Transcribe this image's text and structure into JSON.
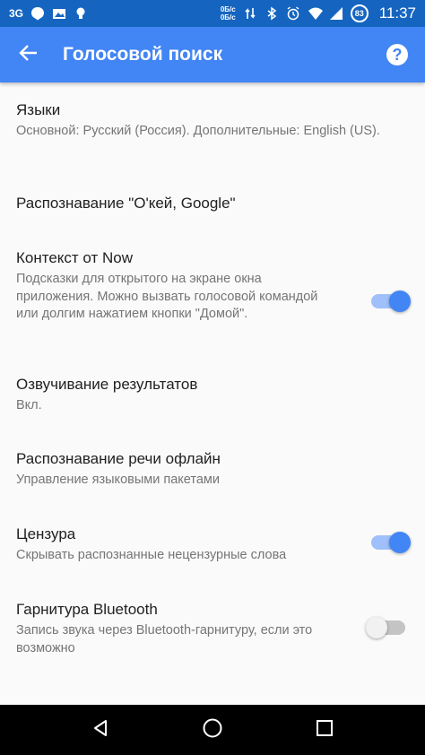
{
  "status_bar": {
    "network": "3G",
    "speed_line1": "0Б/с",
    "speed_line2": "0Б/с",
    "battery": "83",
    "time": "11:37"
  },
  "app_bar": {
    "title": "Голосовой поиск",
    "help_label": "?"
  },
  "settings": {
    "languages": {
      "title": "Языки",
      "subtitle": "Основной: Русский (Россия). Дополнительные: English (US)."
    },
    "ok_google": {
      "title": "Распознавание \"О'кей, Google\""
    },
    "now_context": {
      "title": "Контекст от Now",
      "subtitle": "Подсказки для открытого на экране окна приложения. Можно вызвать голосовой командой или долгим нажатием кнопки \"Домой\".",
      "enabled": true
    },
    "speech_output": {
      "title": "Озвучивание результатов",
      "subtitle": "Вкл."
    },
    "offline": {
      "title": "Распознавание речи офлайн",
      "subtitle": "Управление языковыми пакетами"
    },
    "censorship": {
      "title": "Цензура",
      "subtitle": "Скрывать распознанные нецензурные слова",
      "enabled": true
    },
    "bluetooth": {
      "title": "Гарнитура Bluetooth",
      "subtitle": "Запись звука через Bluetooth-гарнитуру, если это возможно",
      "enabled": false
    }
  },
  "colors": {
    "status_bar": "#1565c0",
    "app_bar": "#4285f4",
    "accent": "#4285f4"
  }
}
